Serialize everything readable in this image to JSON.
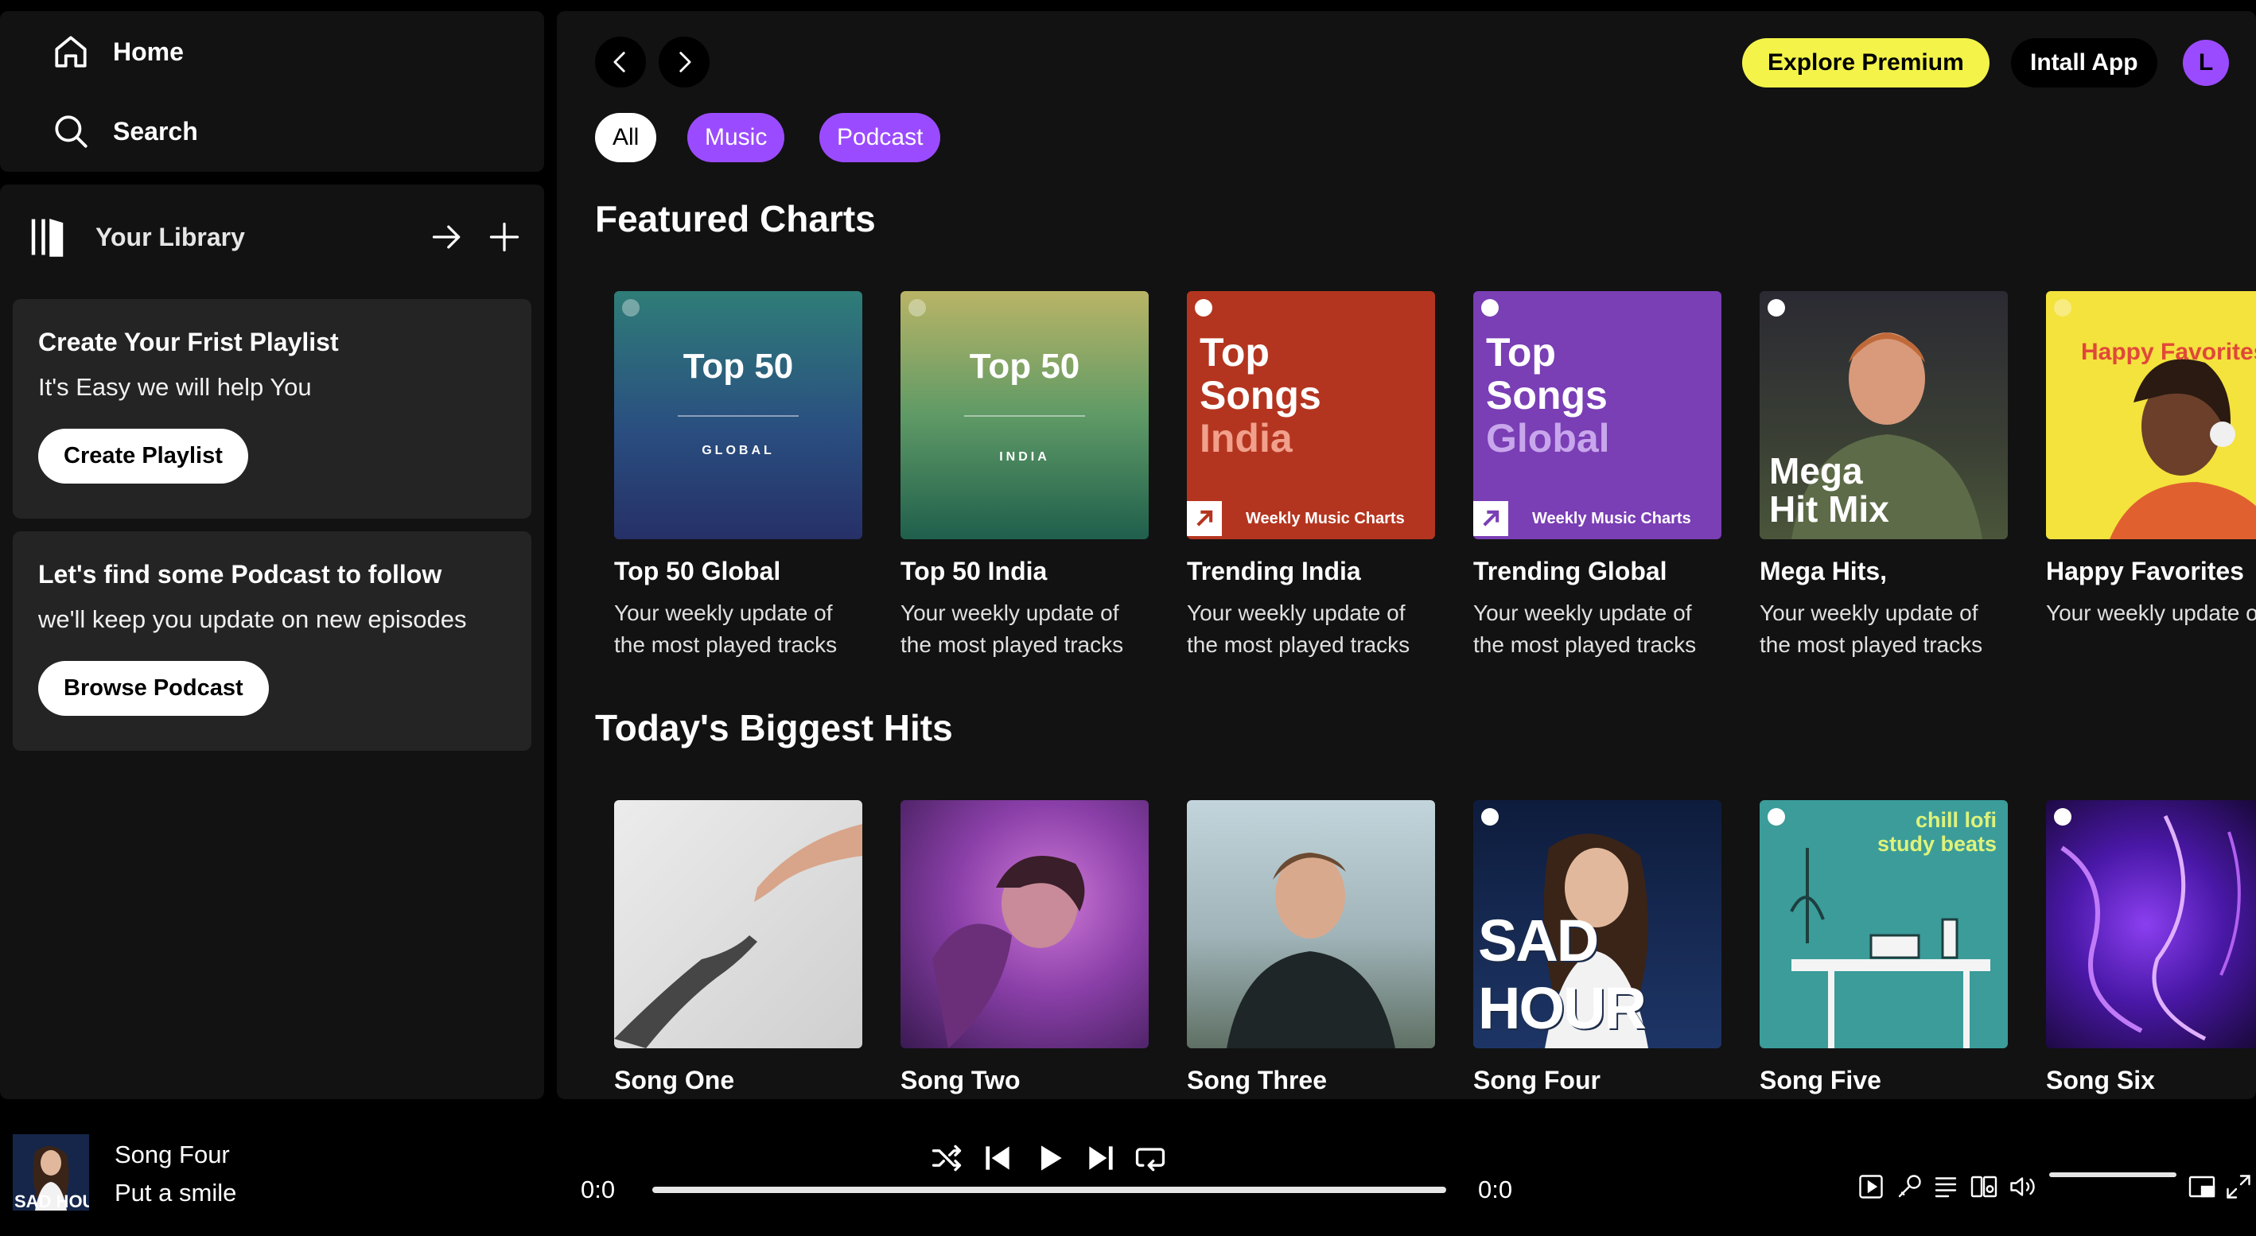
{
  "sidebar": {
    "home_label": "Home",
    "search_label": "Search",
    "library_title": "Your Library",
    "playlist_promo": {
      "title": "Create Your Frist Playlist",
      "subtitle": "It's Easy we will help You",
      "button": "Create Playlist"
    },
    "podcast_promo": {
      "title": "Let's find some Podcast to follow",
      "subtitle": "we'll keep you update on new episodes",
      "button": "Browse Podcast"
    }
  },
  "header": {
    "premium_label": "Explore Premium",
    "install_label": "Intall App",
    "avatar_letter": "L",
    "filters": [
      "All",
      "Music",
      "Podcast"
    ]
  },
  "sections": {
    "featured_title": "Featured Charts",
    "hits_title": "Today's Biggest Hits"
  },
  "featured": [
    {
      "title": "Top 50 Global",
      "desc": "Your weekly update of the most played tracks",
      "cover_main": "Top 50",
      "cover_sub": "GLOBAL"
    },
    {
      "title": "Top 50 India",
      "desc": "Your weekly update of the most played tracks",
      "cover_main": "Top 50",
      "cover_sub": "INDIA"
    },
    {
      "title": "Trending India",
      "desc": "Your weekly update of the most played tracks",
      "cover_main": "Top\nSongs",
      "cover_accent": "India",
      "cover_footer": "Weekly Music Charts"
    },
    {
      "title": "Trending Global",
      "desc": "Your weekly update of the most played tracks",
      "cover_main": "Top\nSongs",
      "cover_accent": "Global",
      "cover_footer": "Weekly Music Charts"
    },
    {
      "title": "Mega Hits,",
      "desc": "Your weekly update of the most played tracks",
      "cover_main": "Mega\nHit Mix"
    },
    {
      "title": "Happy Favorites",
      "desc": "Your weekly update of the most played tracks",
      "cover_main": "Happy Favorites"
    }
  ],
  "hits": [
    {
      "title": "Song One"
    },
    {
      "title": "Song Two"
    },
    {
      "title": "Song Three"
    },
    {
      "title": "Song Four",
      "cover_text": "SAD HOUR"
    },
    {
      "title": "Song Five",
      "cover_text": "chill lofi\nstudy beats"
    },
    {
      "title": "Song Six"
    }
  ],
  "player": {
    "track_title": "Song Four",
    "track_artist": "Put a smile",
    "elapsed": "0:0",
    "duration": "0:0",
    "progress": 0
  },
  "colors": {
    "accent_purple": "#9b4bff",
    "premium_yellow": "#f3f34a",
    "panel_bg": "#121212"
  }
}
